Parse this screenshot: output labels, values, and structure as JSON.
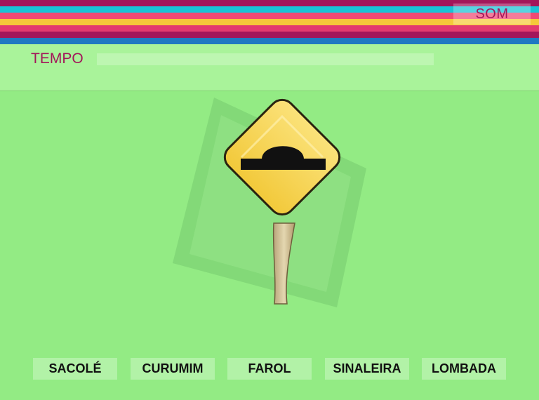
{
  "colors": {
    "background": "#93eb84",
    "header_band": "#a9f39a",
    "accent_text": "#a3165a",
    "option_bg": "#b2f2a7",
    "sign_yellow": "#f7d64d",
    "stripes": [
      "#a3165a",
      "#19c3d6",
      "#f04a73",
      "#f5c93a",
      "#e33b6e",
      "#a3165a",
      "#1f78c2"
    ]
  },
  "toolbar": {
    "sound_label": "SOM"
  },
  "timer": {
    "label": "TEMPO",
    "remaining_fraction": 0.0
  },
  "question": {
    "icon": "speed-bump-sign-icon"
  },
  "options": [
    {
      "label": "SACOLÉ"
    },
    {
      "label": "CURUMIM"
    },
    {
      "label": "FAROL"
    },
    {
      "label": "SINALEIRA"
    },
    {
      "label": "LOMBADA"
    }
  ]
}
